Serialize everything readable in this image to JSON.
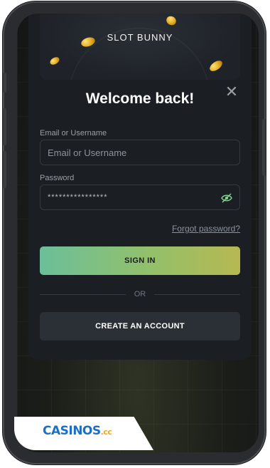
{
  "brand": {
    "logo_text": "SLOT BUNNY"
  },
  "modal": {
    "title": "Welcome back!",
    "close_icon": "close-icon"
  },
  "form": {
    "email": {
      "label": "Email or Username",
      "placeholder": "Email or Username",
      "value": ""
    },
    "password": {
      "label": "Password",
      "masked_value": "****************",
      "toggle_icon": "eye-icon"
    },
    "forgot_password": "Forgot password?",
    "sign_in": "SIGN IN",
    "divider": "OR",
    "create_account": "CREATE AN ACCOUNT"
  },
  "watermark": {
    "text": "CASINOS",
    "suffix": ".cc"
  },
  "colors": {
    "accent_start": "#6bbf9a",
    "accent_end": "#b6b852",
    "modal_bg": "#1b1f24",
    "secondary_button": "#2b2f36"
  }
}
